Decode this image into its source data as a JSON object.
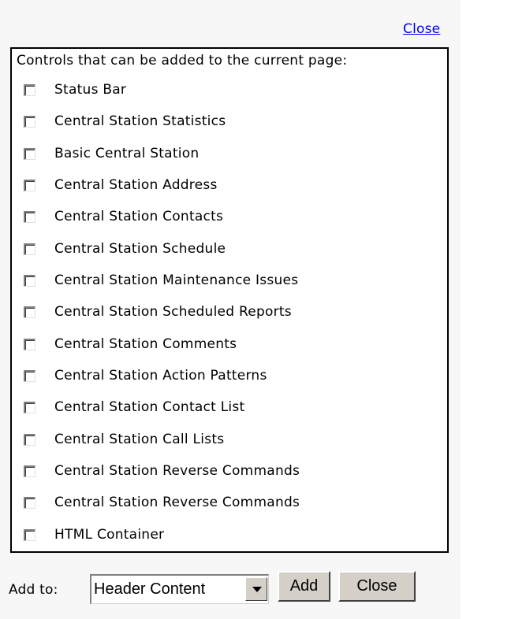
{
  "header": {
    "close_link": "Close"
  },
  "controls_box": {
    "heading": "Controls that can be added to the current page:",
    "items": [
      {
        "label": "Status Bar",
        "checked": false
      },
      {
        "label": "Central Station Statistics",
        "checked": false
      },
      {
        "label": "Basic Central Station",
        "checked": false
      },
      {
        "label": "Central Station Address",
        "checked": false
      },
      {
        "label": "Central Station Contacts",
        "checked": false
      },
      {
        "label": "Central Station Schedule",
        "checked": false
      },
      {
        "label": "Central Station Maintenance Issues",
        "checked": false
      },
      {
        "label": "Central Station Scheduled Reports",
        "checked": false
      },
      {
        "label": "Central Station Comments",
        "checked": false
      },
      {
        "label": "Central Station Action Patterns",
        "checked": false
      },
      {
        "label": "Central Station Contact List",
        "checked": false
      },
      {
        "label": "Central Station Call Lists",
        "checked": false
      },
      {
        "label": "Central Station Reverse Commands",
        "checked": false
      },
      {
        "label": "Central Station Reverse Commands",
        "checked": false
      },
      {
        "label": "HTML Container",
        "checked": false
      }
    ]
  },
  "footer": {
    "add_to_label": "Add to:",
    "select_value": "Header Content",
    "add_button": "Add",
    "close_button": "Close"
  }
}
